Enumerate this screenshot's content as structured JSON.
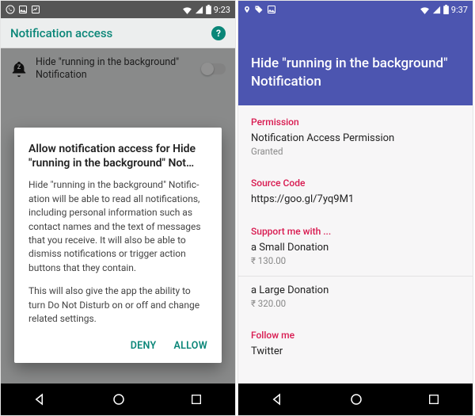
{
  "left": {
    "status": {
      "time": "9:23"
    },
    "actionbar": {
      "title": "Notification access"
    },
    "row": {
      "label": "Hide \"running in the background\" Notification"
    },
    "dialog": {
      "title": "Allow notification access for Hide \"running in the background\" Not…",
      "p1": "Hide \"running in the background\" Notific­ation will be able to read all notifications, including personal information such as contact names and the text of messages that you receive. It will also be able to dismiss notifications or trigger action buttons that they contain.",
      "p2": "This will also give the app the ability to turn Do Not Disturb on or off and change related settings.",
      "deny": "DENY",
      "allow": "ALLOW"
    }
  },
  "right": {
    "status": {
      "time": "9:37"
    },
    "hero": {
      "title": "Hide \"running in the background\" Notification"
    },
    "sections": {
      "permission": {
        "label": "Permission",
        "title": "Notification Access Permission",
        "sub": "Granted"
      },
      "source": {
        "label": "Source Code",
        "title": "https://goo.gl/7yq9M1"
      },
      "support": {
        "label": "Support me with ...",
        "small": {
          "title": "a Small Donation",
          "price": "₹ 130.00"
        },
        "large": {
          "title": "a Large Donation",
          "price": "₹ 320.00"
        }
      },
      "follow": {
        "label": "Follow me",
        "title": "Twitter"
      }
    }
  }
}
